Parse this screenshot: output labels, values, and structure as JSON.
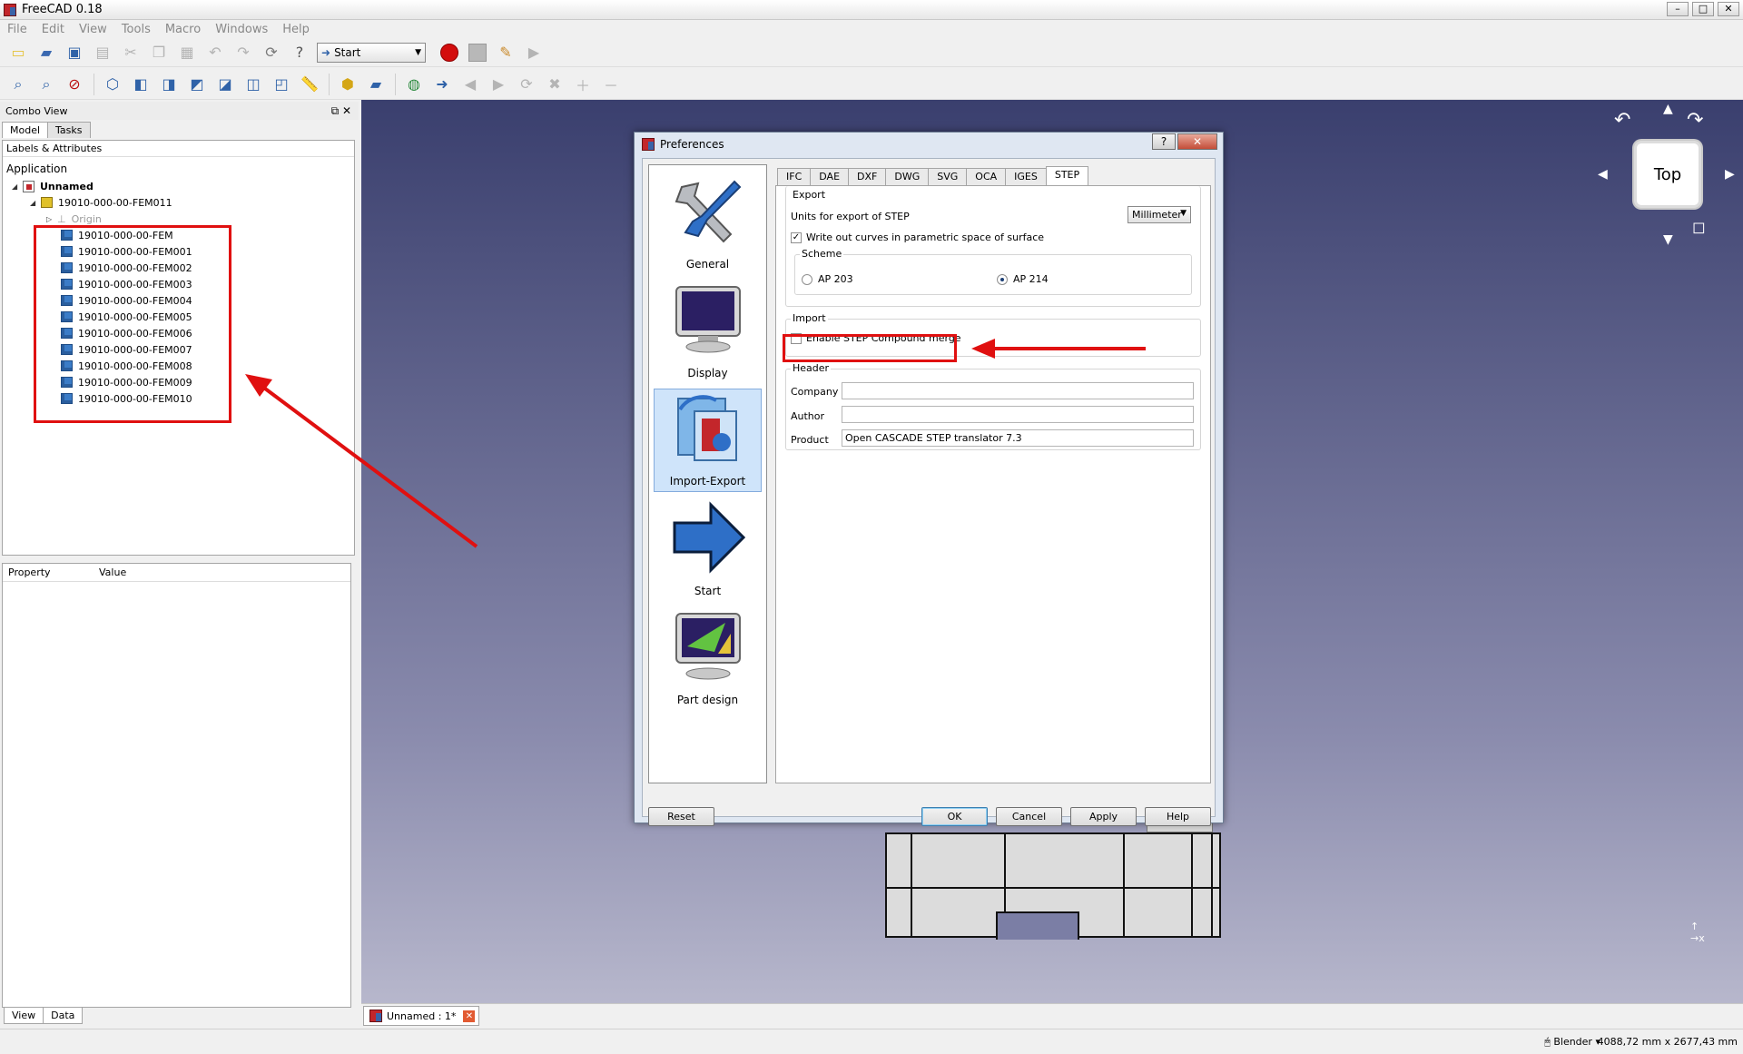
{
  "window": {
    "title": "FreeCAD 0.18"
  },
  "menu": [
    "File",
    "Edit",
    "View",
    "Tools",
    "Macro",
    "Windows",
    "Help"
  ],
  "toolbar": {
    "workbench": "Start"
  },
  "combo_view": {
    "title": "Combo View",
    "tabs": [
      "Model",
      "Tasks"
    ],
    "tree_header": "Labels & Attributes",
    "application": "Application",
    "document": "Unnamed",
    "part": "19010-000-00-FEM011",
    "origin": "Origin",
    "items": [
      "19010-000-00-FEM",
      "19010-000-00-FEM001",
      "19010-000-00-FEM002",
      "19010-000-00-FEM003",
      "19010-000-00-FEM004",
      "19010-000-00-FEM005",
      "19010-000-00-FEM006",
      "19010-000-00-FEM007",
      "19010-000-00-FEM008",
      "19010-000-00-FEM009",
      "19010-000-00-FEM010"
    ],
    "prop_headers": [
      "Property",
      "Value"
    ],
    "bottom_tabs": [
      "View",
      "Data"
    ]
  },
  "navcube": {
    "face": "Top"
  },
  "doc_tab": {
    "label": "Unnamed : 1*"
  },
  "status": {
    "nav": "Blender",
    "dimensions": "4088,72 mm x 2677,43 mm"
  },
  "dialog": {
    "title": "Preferences",
    "pages": [
      "General",
      "Display",
      "Import-Export",
      "Start",
      "Part design"
    ],
    "selected_page": "Import-Export",
    "tabs": [
      "IFC",
      "DAE",
      "DXF",
      "DWG",
      "SVG",
      "OCA",
      "IGES",
      "STEP"
    ],
    "active_tab": "STEP",
    "export": {
      "group": "Export",
      "units_label": "Units for export of STEP",
      "units_value": "Millimeter",
      "curves_label": "Write out curves in parametric space of surface",
      "curves_checked": true,
      "scheme_group": "Scheme",
      "scheme_options": [
        "AP 203",
        "AP 214"
      ],
      "scheme_selected": "AP 214"
    },
    "import": {
      "group": "Import",
      "compound_label": "Enable STEP Compound merge",
      "compound_checked": false
    },
    "header": {
      "group": "Header",
      "company_label": "Company",
      "company_value": "",
      "author_label": "Author",
      "author_value": "",
      "product_label": "Product",
      "product_value": "Open CASCADE STEP translator 7.3"
    },
    "buttons": {
      "reset": "Reset",
      "ok": "OK",
      "cancel": "Cancel",
      "apply": "Apply",
      "help": "Help"
    }
  },
  "colors": {
    "annotation": "#e01010",
    "viewport_top": "#3a3f6e",
    "viewport_bottom": "#b7b7cc"
  }
}
